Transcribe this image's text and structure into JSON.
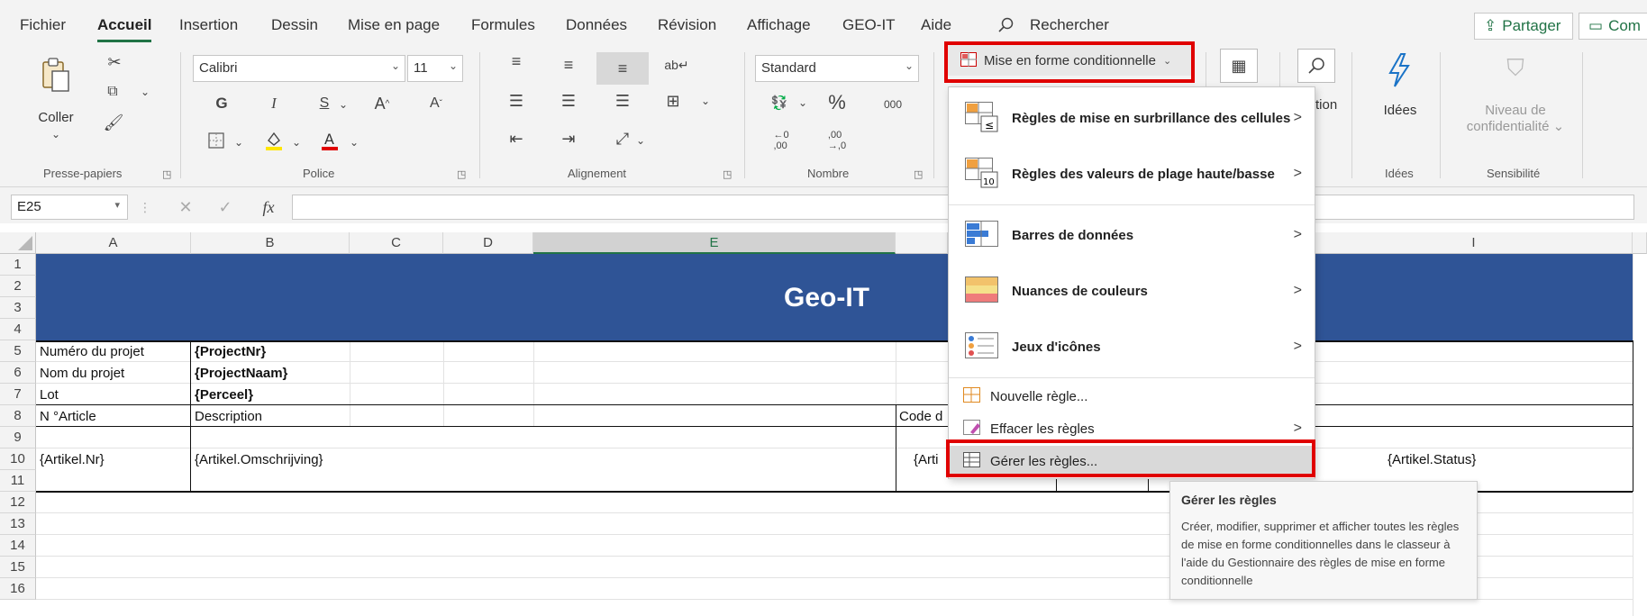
{
  "tabs": [
    {
      "label": "Fichier"
    },
    {
      "label": "Accueil"
    },
    {
      "label": "Insertion"
    },
    {
      "label": "Dessin"
    },
    {
      "label": "Mise en page"
    },
    {
      "label": "Formules"
    },
    {
      "label": "Données"
    },
    {
      "label": "Révision"
    },
    {
      "label": "Affichage"
    },
    {
      "label": "GEO-IT"
    },
    {
      "label": "Aide"
    },
    {
      "label": "Rechercher"
    }
  ],
  "share": {
    "label": "Partager"
  },
  "comments": {
    "label": "Com"
  },
  "clipboard": {
    "paste_label": "Coller",
    "group_label": "Presse-papiers"
  },
  "font": {
    "name": "Calibri",
    "size": "11",
    "bold": "G",
    "italic": "I",
    "underline": "S",
    "group_label": "Police"
  },
  "alignment": {
    "group_label": "Alignement"
  },
  "number": {
    "format": "Standard",
    "percent": "%",
    "thousands": "000",
    "group_label": "Nombre"
  },
  "cond_format": {
    "label": "Mise en forme conditionnelle"
  },
  "ideas": {
    "label": "Idées",
    "group_label": "Idées"
  },
  "sensitivity": {
    "label_line1": "Niveau de",
    "label_line2": "confidentialité",
    "group_label": "Sensibilité"
  },
  "partial_label": "tion",
  "formula_bar": {
    "name_box": "E25",
    "fx": "fx"
  },
  "columns": [
    "A",
    "B",
    "C",
    "D",
    "E",
    "I"
  ],
  "rows": [
    "1",
    "2",
    "3",
    "4",
    "5",
    "6",
    "7",
    "8",
    "9",
    "10",
    "11",
    "12",
    "13",
    "14",
    "15",
    "16"
  ],
  "sheet": {
    "banner_title": "Geo-IT",
    "project_nr_label": "Numéro du projet",
    "project_nr_value": "{ProjectNr}",
    "project_name_label": "Nom du projet",
    "project_name_value": "{ProjectNaam}",
    "lot_label": "Lot",
    "lot_value": "{Perceel}",
    "article_header": "N °Article",
    "description_header": "Description",
    "code_header": "Code d",
    "article_nr": "{Artikel.Nr}",
    "article_desc": "{Artikel.Omschrijving}",
    "article_partial": "{Arti",
    "article_status": "{Artikel.Status}"
  },
  "menu": {
    "items": [
      {
        "label": "Règles de mise en surbrillance des cellules"
      },
      {
        "label": "Règles des valeurs de plage haute/basse"
      },
      {
        "label": "Barres de données"
      },
      {
        "label": "Nuances de couleurs"
      },
      {
        "label": "Jeux d'icônes"
      },
      {
        "label": "Nouvelle règle..."
      },
      {
        "label": "Effacer les règles"
      },
      {
        "label": "Gérer les règles..."
      }
    ]
  },
  "tooltip": {
    "title": "Gérer les règles",
    "body": "Créer, modifier, supprimer et afficher toutes les règles de mise en forme conditionnelles dans le classeur à l'aide du Gestionnaire des règles de mise en forme conditionnelle"
  },
  "colors": {
    "accent": "#217346",
    "banner": "#2f5496",
    "highlight": "#e00000"
  }
}
